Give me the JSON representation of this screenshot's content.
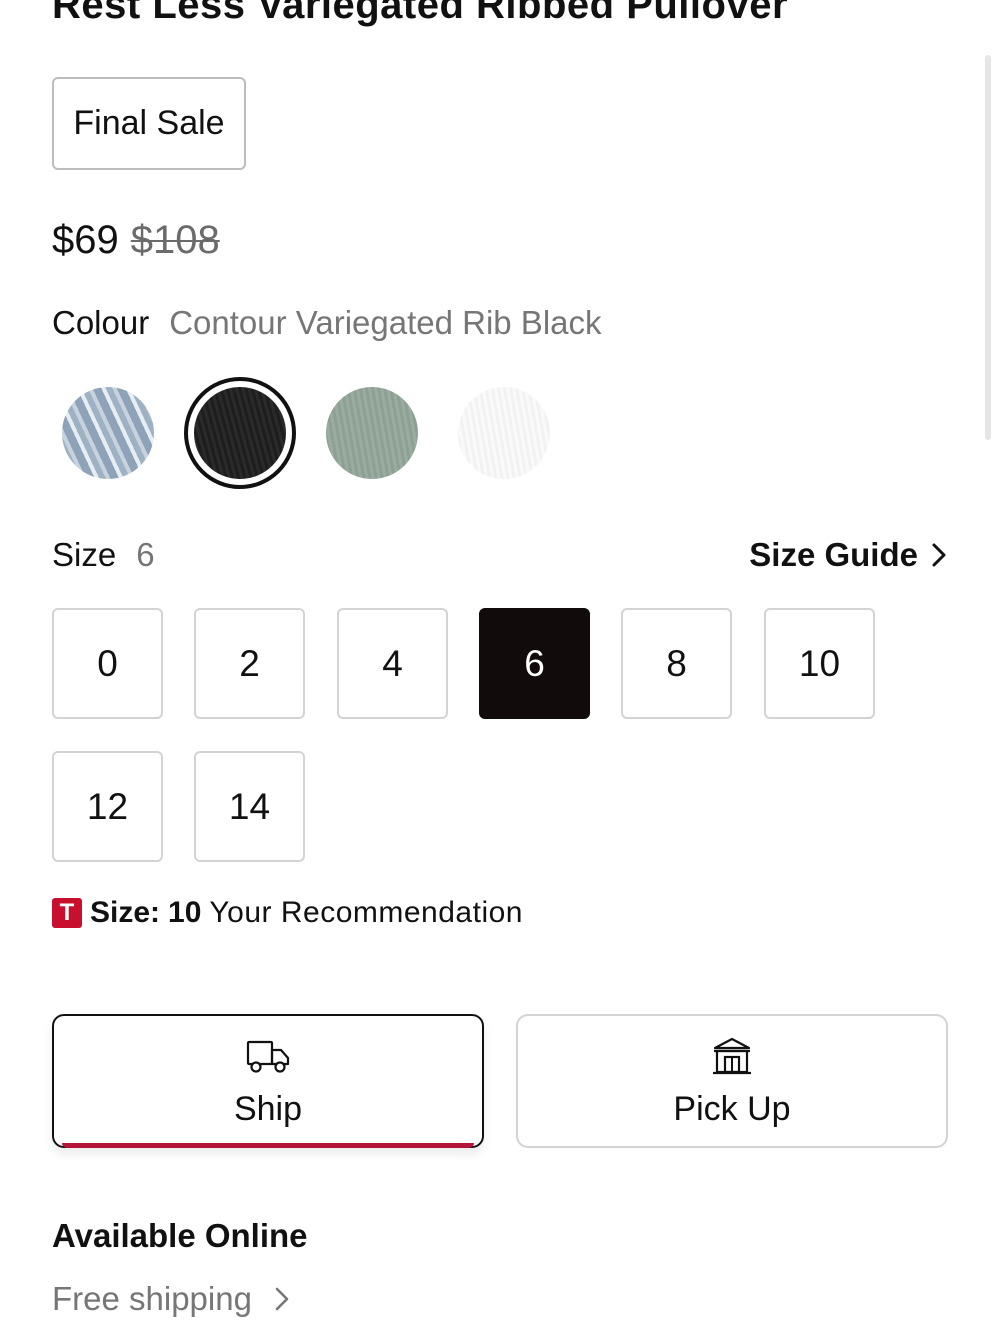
{
  "product": {
    "title": "Rest Less Variegated Ribbed Pullover",
    "badge": "Final Sale",
    "price_current": "$69",
    "price_original": "$108"
  },
  "colour": {
    "label": "Colour",
    "selected": "Contour Variegated Rib Black",
    "swatches": [
      {
        "id": "light-blue-rib",
        "selected": false
      },
      {
        "id": "black-rib",
        "selected": true
      },
      {
        "id": "sage-green-rib",
        "selected": false
      },
      {
        "id": "white-rib",
        "selected": false
      }
    ]
  },
  "size": {
    "label": "Size",
    "selected": "6",
    "guide_label": "Size Guide",
    "options": [
      "0",
      "2",
      "4",
      "6",
      "8",
      "10",
      "12",
      "14"
    ]
  },
  "recommendation": {
    "badge": "T",
    "size_label": "Size:",
    "size_value": "10",
    "text": "Your Recommendation"
  },
  "fulfilment": {
    "ship_label": "Ship",
    "pickup_label": "Pick Up",
    "selected": "ship",
    "accent_color": "#b3143a"
  },
  "availability": {
    "title": "Available Online",
    "shipping_link": "Free shipping"
  },
  "icons": {
    "ship": "truck-icon",
    "pickup": "store-icon",
    "guide_chevron": "chevron-right-icon"
  }
}
